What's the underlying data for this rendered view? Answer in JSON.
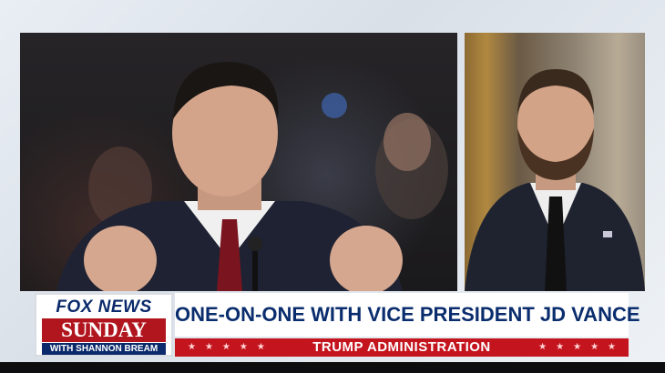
{
  "left_panel": {
    "subject": "man-speaking-at-hearing"
  },
  "right_panel": {
    "subject": "man-in-suit-remote-interview"
  },
  "logo": {
    "network": "FOX NEWS",
    "show": "SUNDAY",
    "host": "WITH SHANNON BREAM"
  },
  "headline": "ONE-ON-ONE WITH VICE PRESIDENT JD VANCE",
  "subhead": "TRUMP ADMINISTRATION",
  "colors": {
    "navy": "#0a2d6e",
    "red": "#c4151f",
    "white": "#ffffff"
  }
}
